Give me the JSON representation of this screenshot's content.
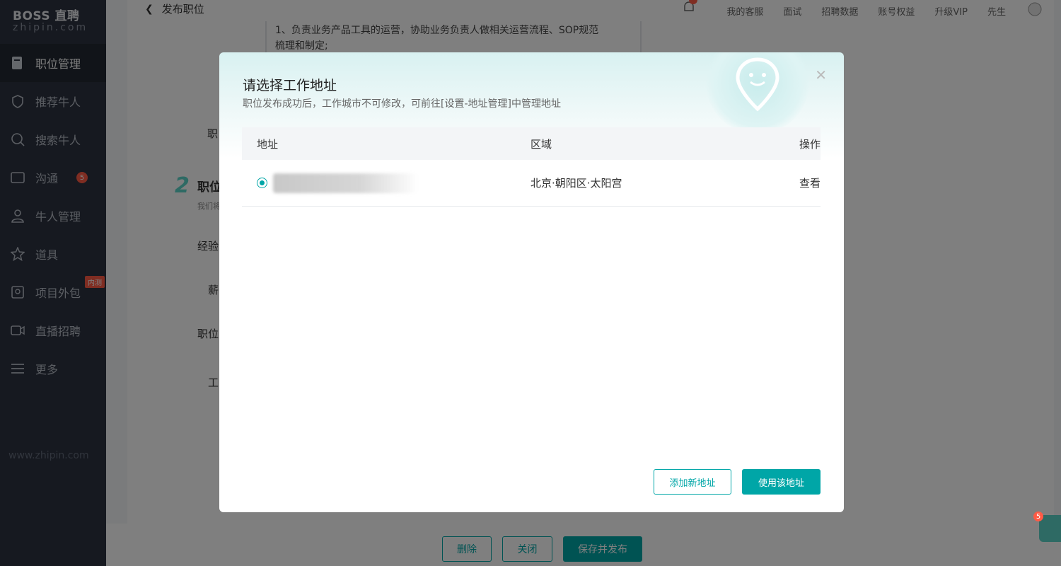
{
  "sidebar": {
    "logo_brand": "BOSS 直聘",
    "logo_sub": "zhipin.com",
    "items": [
      {
        "label": "职位管理",
        "icon": "document-icon",
        "active": true
      },
      {
        "label": "推荐牛人",
        "icon": "shield-icon"
      },
      {
        "label": "搜索牛人",
        "icon": "search-icon"
      },
      {
        "label": "沟通",
        "icon": "chat-icon",
        "badge": "5"
      },
      {
        "label": "牛人管理",
        "icon": "person-icon"
      },
      {
        "label": "道具",
        "icon": "star-icon"
      },
      {
        "label": "项目外包",
        "icon": "box-icon",
        "tag": "内测"
      },
      {
        "label": "直播招聘",
        "icon": "video-icon"
      },
      {
        "label": "更多",
        "icon": "menu-icon"
      }
    ],
    "footer": "www.zhipin.com"
  },
  "header": {
    "back_label": "发布职位",
    "links": [
      "我的客服",
      "面试",
      "招聘数据",
      "账号权益",
      "升级VIP",
      "先生"
    ]
  },
  "form": {
    "desc_line1": "1、负责业务产品工具的运营，协助业务负责人做相关运营流程、SOP规范",
    "desc_line2": "梳理和制定;",
    "label_job": "职",
    "step_num": "2",
    "step_title": "职位",
    "step_sub": "我们将",
    "label_exp": "经验",
    "label_salary": "薪",
    "label_position": "职位",
    "label_work": "工"
  },
  "bottom": {
    "delete": "删除",
    "close": "关闭",
    "save_publish": "保存并发布"
  },
  "chat_badge": "5",
  "modal": {
    "title": "请选择工作地址",
    "subtitle": "职位发布成功后，工作城市不可修改，可前往[设置-地址管理]中管理地址",
    "columns": [
      "地址",
      "区域",
      "操作"
    ],
    "rows": [
      {
        "region": "北京·朝阳区·太阳宫",
        "action": "查看",
        "selected": true
      }
    ],
    "add_button": "添加新地址",
    "use_button": "使用该地址"
  },
  "colors": {
    "accent": "#00a6a7",
    "sidebar_bg": "#2d3340",
    "badge": "#ff5a45"
  }
}
